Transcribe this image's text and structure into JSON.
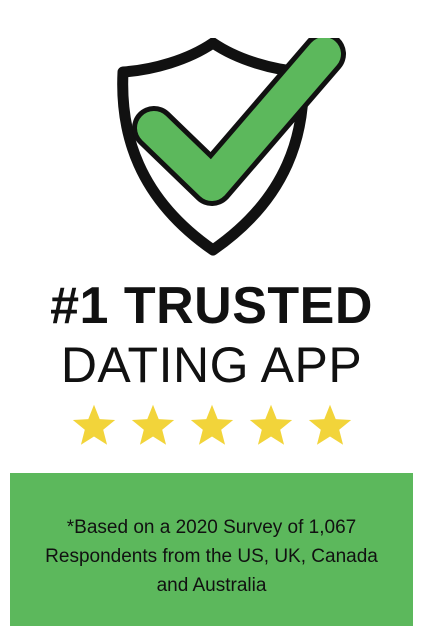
{
  "headline": {
    "line1": "#1 TRUSTED",
    "line2": "DATING APP"
  },
  "rating": {
    "stars": 5,
    "star_color": "#f2d43a"
  },
  "footnote": {
    "text": "*Based on a 2020 Survey of 1,067 Respondents from the US, UK, Canada and Australia",
    "background_color": "#5cb85c"
  },
  "icons": {
    "shield": "shield-icon",
    "check": "checkmark-icon",
    "star": "star-icon"
  },
  "colors": {
    "check_green": "#5cb85c",
    "shield_black": "#111111",
    "text": "#111111"
  }
}
